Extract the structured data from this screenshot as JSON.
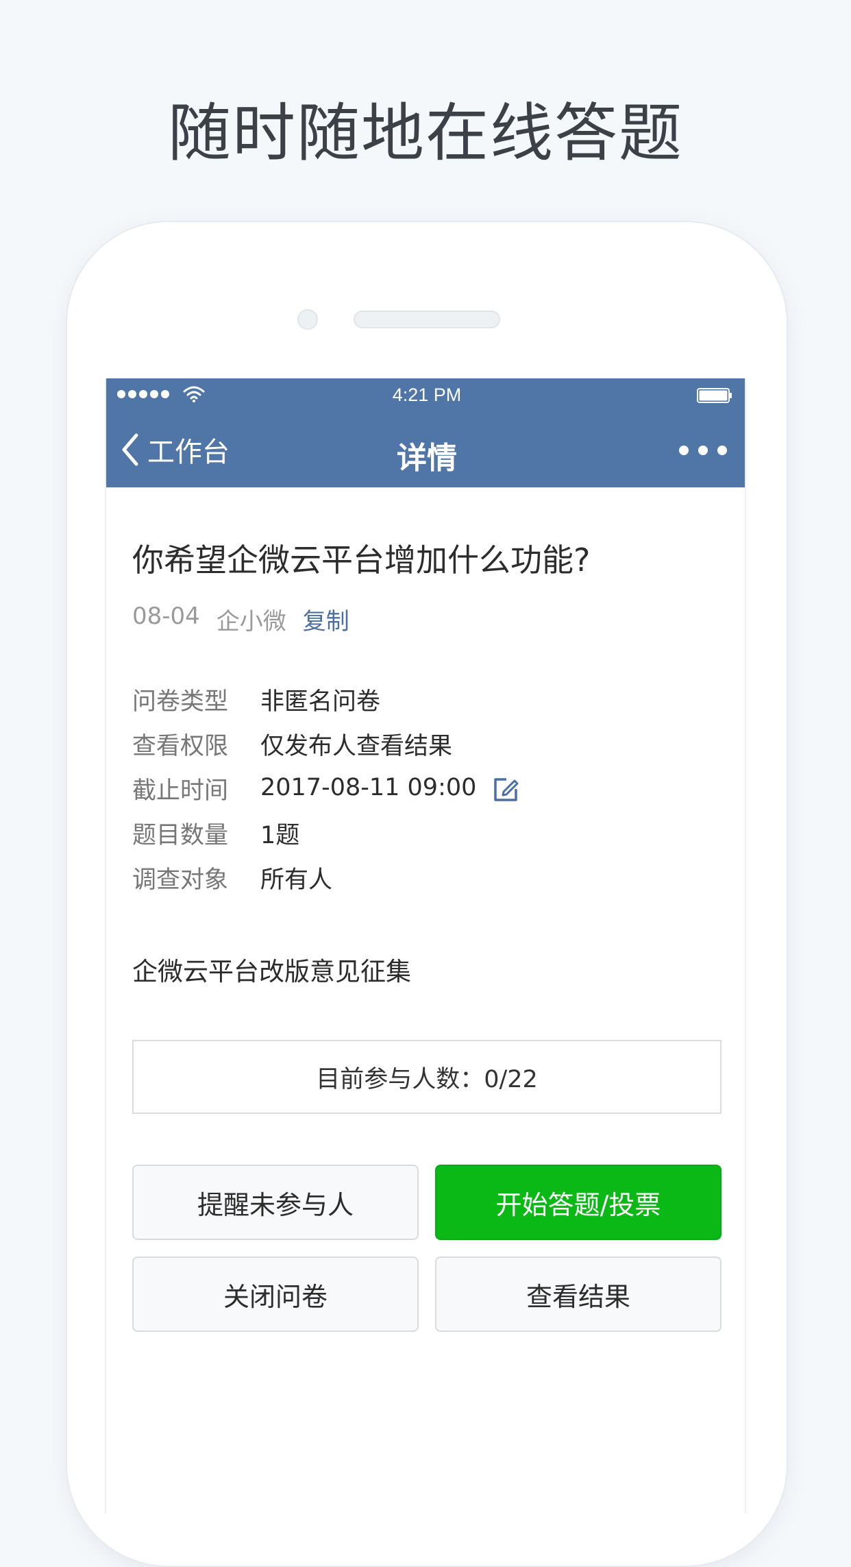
{
  "promo": {
    "title": "随时随地在线答题"
  },
  "status_bar": {
    "time": "4:21 PM"
  },
  "nav": {
    "back_label": "工作台",
    "title": "详情"
  },
  "survey": {
    "title": "你希望企微云平台增加什么功能?",
    "date": "08-04",
    "author": "企小微",
    "copy_label": "复制",
    "info": [
      {
        "label": "问卷类型",
        "value": "非匿名问卷"
      },
      {
        "label": "查看权限",
        "value": "仅发布人查看结果"
      },
      {
        "label": "截止时间",
        "value": "2017-08-11 09:00"
      },
      {
        "label": "题目数量",
        "value": "1题"
      },
      {
        "label": "调查对象",
        "value": "所有人"
      }
    ],
    "description": "企微云平台改版意见征集",
    "participants": "目前参与人数：0/22"
  },
  "buttons": {
    "remind": "提醒未参与人",
    "start": "开始答题/投票",
    "close": "关闭问卷",
    "results": "查看结果"
  },
  "colors": {
    "nav_background": "#4f76a7",
    "primary_button": "#0ab816",
    "link": "#4a6fa5",
    "page_background": "#f5f8fb"
  },
  "icons": {
    "back": "chevron-left-icon",
    "more": "more-dots-icon",
    "edit": "edit-icon",
    "wifi": "wifi-icon",
    "battery": "battery-icon"
  }
}
